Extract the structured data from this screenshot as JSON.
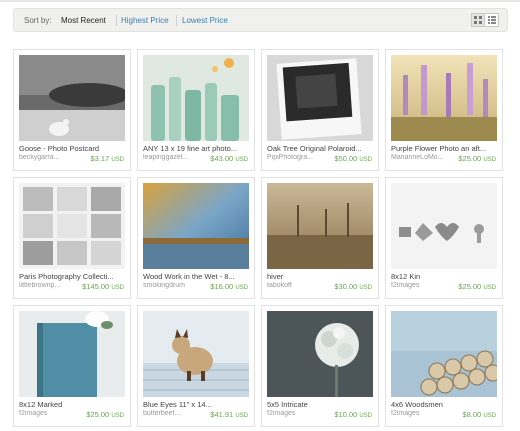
{
  "sort": {
    "label": "Sort by:",
    "options": [
      "Most Recent",
      "Highest Price",
      "Lowest Price"
    ]
  },
  "view": {
    "grid_icon": "grid-view-icon",
    "list_icon": "list-view-icon"
  },
  "currency": "USD",
  "colors": {
    "price": "#6aa84f",
    "link": "#3a7fb0"
  },
  "items": [
    {
      "title": "Goose - Photo Postcard",
      "shop": "beckygarra...",
      "price": "$3.17"
    },
    {
      "title": "ANY 13 x 19 fine art photo...",
      "shop": "leapinggazel...",
      "price": "$43.00"
    },
    {
      "title": "Oak Tree Original Polaroid...",
      "shop": "PipiPhotogra...",
      "price": "$50.00"
    },
    {
      "title": "Purple Flower Photo an aft...",
      "shop": "MarianneLoMo...",
      "price": "$25.00"
    },
    {
      "title": "Paris Photography Collecti...",
      "shop": "littlebrownp...",
      "price": "$145.00"
    },
    {
      "title": "Wood Work in the Wet - 8...",
      "shop": "smokingdrum",
      "price": "$16.00"
    },
    {
      "title": "hiver",
      "shop": "tabokoff",
      "price": "$30.00"
    },
    {
      "title": "8x12 Kin",
      "shop": "f2images",
      "price": "$25.00"
    },
    {
      "title": "8x12 Marked",
      "shop": "f2images",
      "price": "$25.00"
    },
    {
      "title": "Blue Eyes 11\" x 14...",
      "shop": "butterbeef...",
      "price": "$41.91"
    },
    {
      "title": "5x5 Intricate",
      "shop": "f2images",
      "price": "$10.00"
    },
    {
      "title": "4x6 Woodsmen",
      "shop": "f2images",
      "price": "$8.00"
    }
  ]
}
